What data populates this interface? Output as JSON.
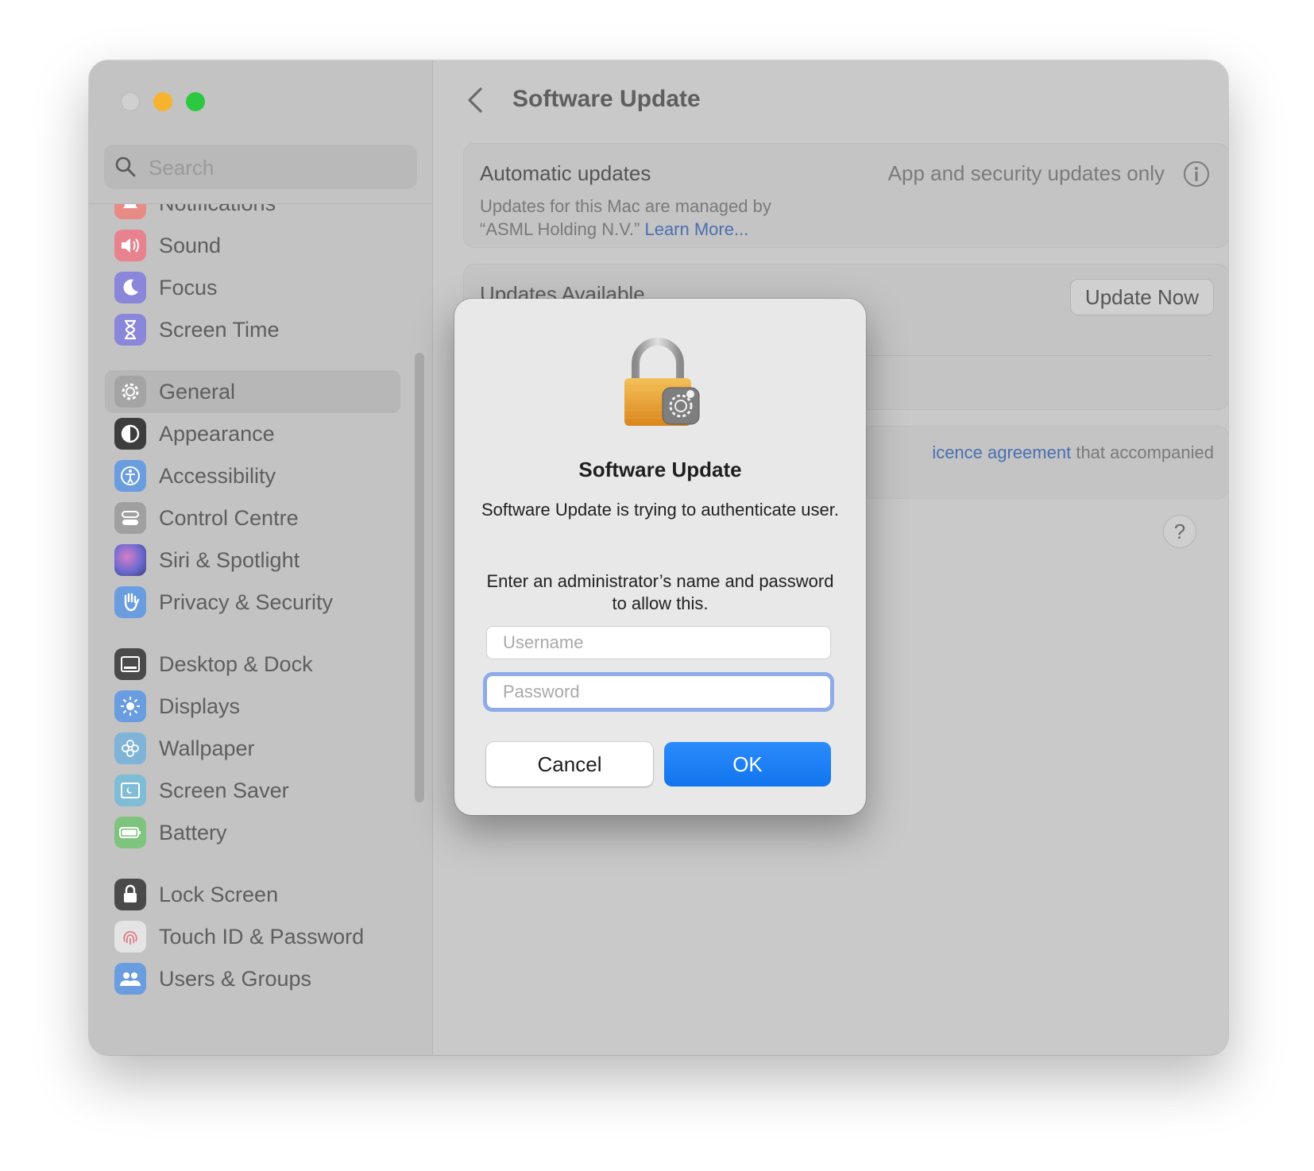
{
  "search": {
    "placeholder": "Search"
  },
  "sidebar": {
    "items": [
      {
        "label": "Notifications",
        "icon": "bell-icon",
        "color": "#e88a86"
      },
      {
        "label": "Sound",
        "icon": "speaker-icon",
        "color": "#e8828e"
      },
      {
        "label": "Focus",
        "icon": "moon-icon",
        "color": "#8a86d9"
      },
      {
        "label": "Screen Time",
        "icon": "hourglass-icon",
        "color": "#8a86d9"
      },
      {
        "label": "General",
        "icon": "gear-icon",
        "color": "#a4a4a4",
        "selected": true
      },
      {
        "label": "Appearance",
        "icon": "appearance-icon",
        "color": "#3d3d3d"
      },
      {
        "label": "Accessibility",
        "icon": "accessibility-icon",
        "color": "#6a9de0"
      },
      {
        "label": "Control Centre",
        "icon": "toggles-icon",
        "color": "#a0a0a0"
      },
      {
        "label": "Siri & Spotlight",
        "icon": "siri-icon",
        "color": "#7b7ad0"
      },
      {
        "label": "Privacy & Security",
        "icon": "hand-icon",
        "color": "#6a9de0"
      },
      {
        "label": "Desktop & Dock",
        "icon": "dock-icon",
        "color": "#4a4a4a"
      },
      {
        "label": "Displays",
        "icon": "sun-icon",
        "color": "#6a9de0"
      },
      {
        "label": "Wallpaper",
        "icon": "flower-icon",
        "color": "#7fb4d8"
      },
      {
        "label": "Screen Saver",
        "icon": "screensaver-icon",
        "color": "#7fbcd6"
      },
      {
        "label": "Battery",
        "icon": "battery-icon",
        "color": "#7ec47e"
      },
      {
        "label": "Lock Screen",
        "icon": "lock-icon",
        "color": "#4a4a4a"
      },
      {
        "label": "Touch ID & Password",
        "icon": "fingerprint-icon",
        "color": "#e4e4e4"
      },
      {
        "label": "Users & Groups",
        "icon": "users-icon",
        "color": "#6a9de0"
      }
    ]
  },
  "main": {
    "title": "Software Update",
    "automatic": {
      "title": "Automatic updates",
      "desc_line1": "Updates for this Mac are managed by",
      "desc_line2": "“ASML Holding N.V.”",
      "link": "Learn More...",
      "value": "App and security updates only"
    },
    "updates": {
      "title": "Updates Available",
      "update_now": "Update Now"
    },
    "licence": {
      "link": "icence agreement",
      "text": "that accompanied"
    },
    "help": "?"
  },
  "dialog": {
    "title": "Software Update",
    "message": "Software Update is trying to authenticate user.",
    "prompt": "Enter an administrator’s name and password to allow this.",
    "username_placeholder": "Username",
    "password_placeholder": "Password",
    "cancel": "Cancel",
    "ok": "OK"
  },
  "colors": {
    "accent": "#1a7ef5",
    "link": "#4a6fb0"
  }
}
